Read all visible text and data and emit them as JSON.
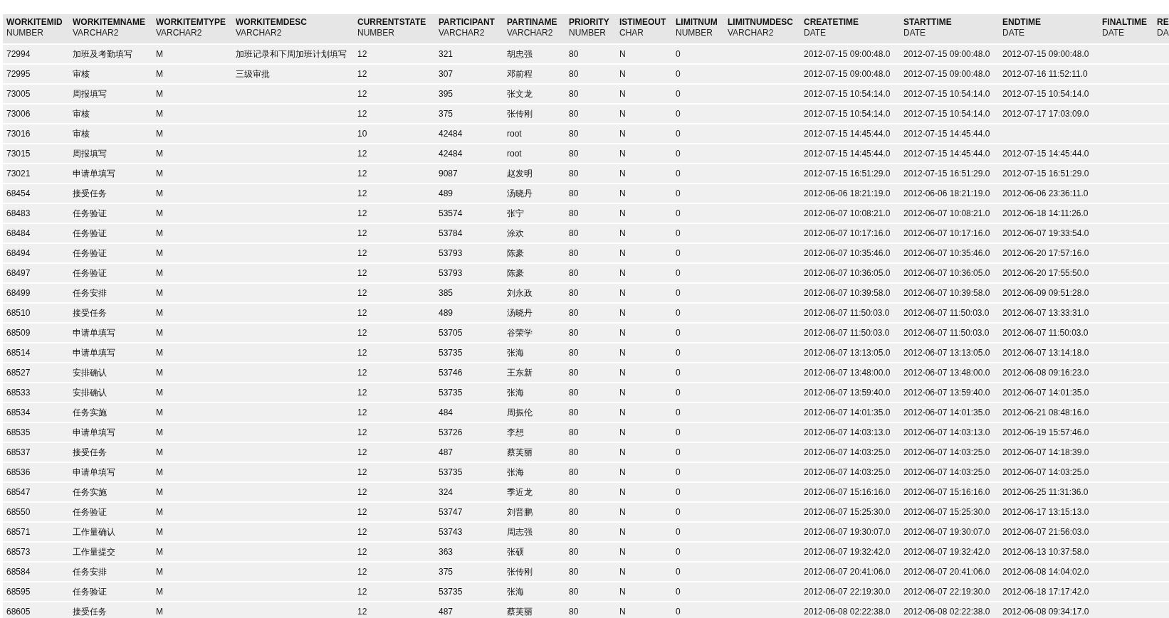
{
  "table": {
    "columns": [
      {
        "name": "WORKITEMID",
        "type": "NUMBER"
      },
      {
        "name": "WORKITEMNAME",
        "type": "VARCHAR2"
      },
      {
        "name": "WORKITEMTYPE",
        "type": "VARCHAR2"
      },
      {
        "name": "WORKITEMDESC",
        "type": "VARCHAR2"
      },
      {
        "name": "CURRENTSTATE",
        "type": "NUMBER"
      },
      {
        "name": "PARTICIPANT",
        "type": "VARCHAR2"
      },
      {
        "name": "PARTINAME",
        "type": "VARCHAR2"
      },
      {
        "name": "PRIORITY",
        "type": "NUMBER"
      },
      {
        "name": "ISTIMEOUT",
        "type": "CHAR"
      },
      {
        "name": "LIMITNUM",
        "type": "NUMBER"
      },
      {
        "name": "LIMITNUMDESC",
        "type": "VARCHAR2"
      },
      {
        "name": "CREATETIME",
        "type": "DATE"
      },
      {
        "name": "STARTTIME",
        "type": "DATE"
      },
      {
        "name": "ENDTIME",
        "type": "DATE"
      },
      {
        "name": "FINALTIME",
        "type": "DATE"
      },
      {
        "name": "RE",
        "type": "DA"
      }
    ],
    "rows": [
      [
        "72994",
        "加班及考勤填写",
        "M",
        "加班记录和下周加班计划填写",
        "12",
        "321",
        "胡忠强",
        "80",
        "N",
        "0",
        null,
        "2012-07-15 09:00:48.0",
        "2012-07-15 09:00:48.0",
        "2012-07-15 09:00:48.0"
      ],
      [
        "72995",
        "审核",
        "M",
        "三级审批",
        "12",
        "307",
        "邓前程",
        "80",
        "N",
        "0",
        null,
        "2012-07-15 09:00:48.0",
        "2012-07-15 09:00:48.0",
        "2012-07-16 11:52:11.0"
      ],
      [
        "73005",
        "周报填写",
        "M",
        null,
        "12",
        "395",
        "张文龙",
        "80",
        "N",
        "0",
        null,
        "2012-07-15 10:54:14.0",
        "2012-07-15 10:54:14.0",
        "2012-07-15 10:54:14.0"
      ],
      [
        "73006",
        "审核",
        "M",
        null,
        "12",
        "375",
        "张传刚",
        "80",
        "N",
        "0",
        null,
        "2012-07-15 10:54:14.0",
        "2012-07-15 10:54:14.0",
        "2012-07-17 17:03:09.0"
      ],
      [
        "73016",
        "审核",
        "M",
        null,
        "10",
        "42484",
        "root",
        "80",
        "N",
        "0",
        null,
        "2012-07-15 14:45:44.0",
        "2012-07-15 14:45:44.0",
        null
      ],
      [
        "73015",
        "周报填写",
        "M",
        null,
        "12",
        "42484",
        "root",
        "80",
        "N",
        "0",
        null,
        "2012-07-15 14:45:44.0",
        "2012-07-15 14:45:44.0",
        "2012-07-15 14:45:44.0"
      ],
      [
        "73021",
        "申请单填写",
        "M",
        null,
        "12",
        "9087",
        "赵发明",
        "80",
        "N",
        "0",
        null,
        "2012-07-15 16:51:29.0",
        "2012-07-15 16:51:29.0",
        "2012-07-15 16:51:29.0"
      ],
      [
        "68454",
        "接受任务",
        "M",
        null,
        "12",
        "489",
        "汤晓丹",
        "80",
        "N",
        "0",
        null,
        "2012-06-06 18:21:19.0",
        "2012-06-06 18:21:19.0",
        "2012-06-06 23:36:11.0"
      ],
      [
        "68483",
        "任务验证",
        "M",
        null,
        "12",
        "53574",
        "张宁",
        "80",
        "N",
        "0",
        null,
        "2012-06-07 10:08:21.0",
        "2012-06-07 10:08:21.0",
        "2012-06-18 14:11:26.0"
      ],
      [
        "68484",
        "任务验证",
        "M",
        null,
        "12",
        "53784",
        "涂欢",
        "80",
        "N",
        "0",
        null,
        "2012-06-07 10:17:16.0",
        "2012-06-07 10:17:16.0",
        "2012-06-07 19:33:54.0"
      ],
      [
        "68494",
        "任务验证",
        "M",
        null,
        "12",
        "53793",
        "陈豪",
        "80",
        "N",
        "0",
        null,
        "2012-06-07 10:35:46.0",
        "2012-06-07 10:35:46.0",
        "2012-06-20 17:57:16.0"
      ],
      [
        "68497",
        "任务验证",
        "M",
        null,
        "12",
        "53793",
        "陈豪",
        "80",
        "N",
        "0",
        null,
        "2012-06-07 10:36:05.0",
        "2012-06-07 10:36:05.0",
        "2012-06-20 17:55:50.0"
      ],
      [
        "68499",
        "任务安排",
        "M",
        null,
        "12",
        "385",
        "刘永政",
        "80",
        "N",
        "0",
        null,
        "2012-06-07 10:39:58.0",
        "2012-06-07 10:39:58.0",
        "2012-06-09 09:51:28.0"
      ],
      [
        "68510",
        "接受任务",
        "M",
        null,
        "12",
        "489",
        "汤晓丹",
        "80",
        "N",
        "0",
        null,
        "2012-06-07 11:50:03.0",
        "2012-06-07 11:50:03.0",
        "2012-06-07 13:33:31.0"
      ],
      [
        "68509",
        "申请单填写",
        "M",
        null,
        "12",
        "53705",
        "谷荣学",
        "80",
        "N",
        "0",
        null,
        "2012-06-07 11:50:03.0",
        "2012-06-07 11:50:03.0",
        "2012-06-07 11:50:03.0"
      ],
      [
        "68514",
        "申请单填写",
        "M",
        null,
        "12",
        "53735",
        "张海",
        "80",
        "N",
        "0",
        null,
        "2012-06-07 13:13:05.0",
        "2012-06-07 13:13:05.0",
        "2012-06-07 13:14:18.0"
      ],
      [
        "68527",
        "安排确认",
        "M",
        null,
        "12",
        "53746",
        "王东新",
        "80",
        "N",
        "0",
        null,
        "2012-06-07 13:48:00.0",
        "2012-06-07 13:48:00.0",
        "2012-06-08 09:16:23.0"
      ],
      [
        "68533",
        "安排确认",
        "M",
        null,
        "12",
        "53735",
        "张海",
        "80",
        "N",
        "0",
        null,
        "2012-06-07 13:59:40.0",
        "2012-06-07 13:59:40.0",
        "2012-06-07 14:01:35.0"
      ],
      [
        "68534",
        "任务实施",
        "M",
        null,
        "12",
        "484",
        "周振伦",
        "80",
        "N",
        "0",
        null,
        "2012-06-07 14:01:35.0",
        "2012-06-07 14:01:35.0",
        "2012-06-21 08:48:16.0"
      ],
      [
        "68535",
        "申请单填写",
        "M",
        null,
        "12",
        "53726",
        "李想",
        "80",
        "N",
        "0",
        null,
        "2012-06-07 14:03:13.0",
        "2012-06-07 14:03:13.0",
        "2012-06-19 15:57:46.0"
      ],
      [
        "68537",
        "接受任务",
        "M",
        null,
        "12",
        "487",
        "蔡芙丽",
        "80",
        "N",
        "0",
        null,
        "2012-06-07 14:03:25.0",
        "2012-06-07 14:03:25.0",
        "2012-06-07 14:18:39.0"
      ],
      [
        "68536",
        "申请单填写",
        "M",
        null,
        "12",
        "53735",
        "张海",
        "80",
        "N",
        "0",
        null,
        "2012-06-07 14:03:25.0",
        "2012-06-07 14:03:25.0",
        "2012-06-07 14:03:25.0"
      ],
      [
        "68547",
        "任务实施",
        "M",
        null,
        "12",
        "324",
        "季近龙",
        "80",
        "N",
        "0",
        null,
        "2012-06-07 15:16:16.0",
        "2012-06-07 15:16:16.0",
        "2012-06-25 11:31:36.0"
      ],
      [
        "68550",
        "任务验证",
        "M",
        null,
        "12",
        "53747",
        "刘晋鹏",
        "80",
        "N",
        "0",
        null,
        "2012-06-07 15:25:30.0",
        "2012-06-07 15:25:30.0",
        "2012-06-17 13:15:13.0"
      ],
      [
        "68571",
        "工作量确认",
        "M",
        null,
        "12",
        "53743",
        "周志强",
        "80",
        "N",
        "0",
        null,
        "2012-06-07 19:30:07.0",
        "2012-06-07 19:30:07.0",
        "2012-06-07 21:56:03.0"
      ],
      [
        "68573",
        "工作量提交",
        "M",
        null,
        "12",
        "363",
        "张硕",
        "80",
        "N",
        "0",
        null,
        "2012-06-07 19:32:42.0",
        "2012-06-07 19:32:42.0",
        "2012-06-13 10:37:58.0"
      ],
      [
        "68584",
        "任务安排",
        "M",
        null,
        "12",
        "375",
        "张传刚",
        "80",
        "N",
        "0",
        null,
        "2012-06-07 20:41:06.0",
        "2012-06-07 20:41:06.0",
        "2012-06-08 14:04:02.0"
      ],
      [
        "68595",
        "任务验证",
        "M",
        null,
        "12",
        "53735",
        "张海",
        "80",
        "N",
        "0",
        null,
        "2012-06-07 22:19:30.0",
        "2012-06-07 22:19:30.0",
        "2012-06-18 17:17:42.0"
      ],
      [
        "68605",
        "接受任务",
        "M",
        null,
        "12",
        "487",
        "蔡芙丽",
        "80",
        "N",
        "0",
        null,
        "2012-06-08 02:22:38.0",
        "2012-06-08 02:22:38.0",
        "2012-06-08 09:34:17.0"
      ]
    ]
  }
}
